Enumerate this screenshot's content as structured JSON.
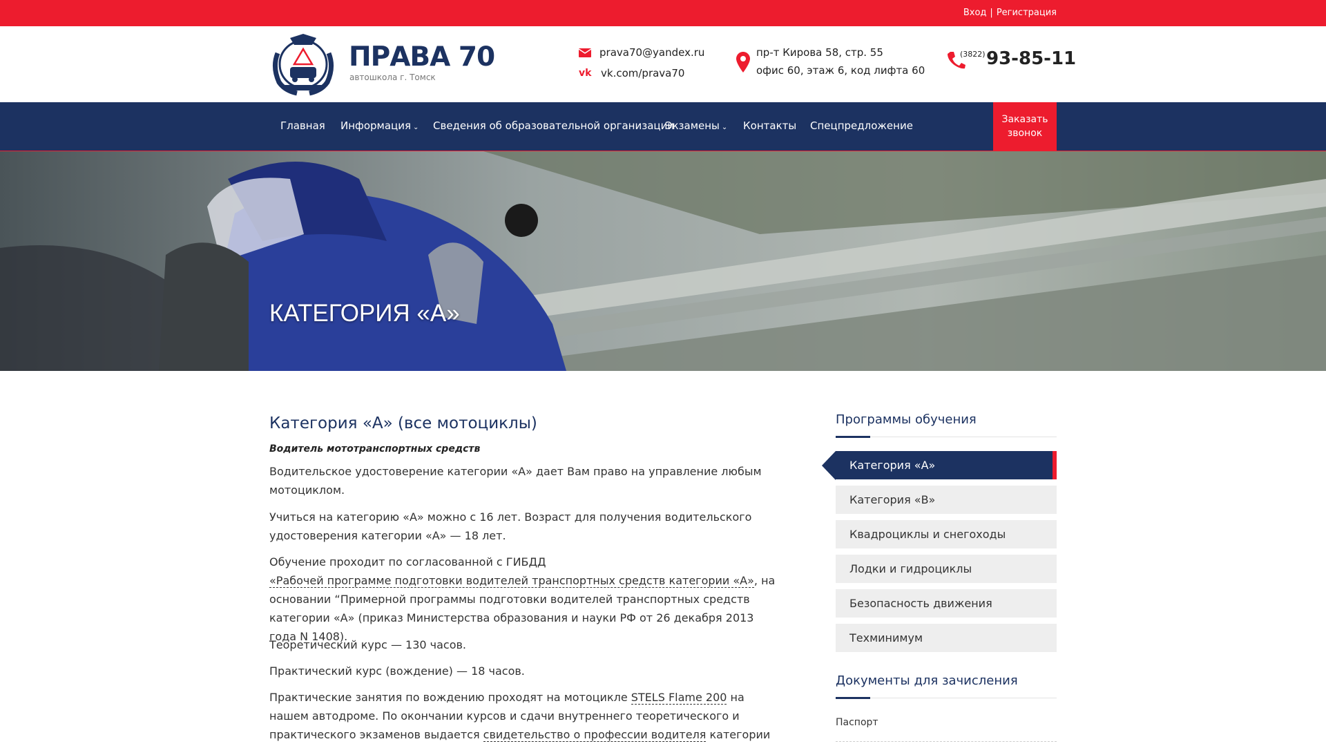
{
  "topbar": {
    "login": "Вход",
    "separator": "|",
    "register": "Регистрация"
  },
  "header": {
    "logo_title": "ПРАВА 70",
    "logo_subtitle": "автошкола г. Томск",
    "email": "prava70@yandex.ru",
    "vk": "vk.com/prava70",
    "address_line1": "пр-т Кирова 58, стр. 55",
    "address_line2": "офис 60, этаж 6, код лифта 60",
    "phone_code": "(3822)",
    "phone_number": "93-85-11"
  },
  "nav": {
    "items": [
      {
        "label": "Главная",
        "dropdown": false
      },
      {
        "label": "Информация",
        "dropdown": true
      },
      {
        "label": "Сведения об образовательной организации",
        "dropdown": false
      },
      {
        "label": "Экзамены",
        "dropdown": true
      },
      {
        "label": "Контакты",
        "dropdown": false
      },
      {
        "label": "Спецпредложение",
        "dropdown": false
      }
    ],
    "cta_line1": "Заказать",
    "cta_line2": "звонок"
  },
  "hero": {
    "title": "КАТЕГОРИЯ «А»"
  },
  "main": {
    "heading": "Категория «А» (все мотоциклы)",
    "subheading": "Водитель мототранспортных средств",
    "p1": "Водительское удостоверение категории «А» дает Вам право на управление любым мотоциклом.",
    "p2": "Учиться на категорию «А» можно с 16 лет. Возраст для получения водительского удостоверения категории «А» — 18 лет.",
    "p3_a": "Обучение проходит по согласованной с ГИБДД",
    "p3_link": "«Рабочей программе подготовки водителей транспортных средств категории «А»",
    "p3_b": ", на основании “Примерной программы подготовки водителей транспортных средств категории «А» (приказ Министерства образования и науки РФ от 26 декабря 2013 года N 1408).",
    "p4": "Теоретический курс — 130 часов.",
    "p5": "Практический курс (вождение) — 18 часов.",
    "p6_a": "Практические занятия по вождению проходят на мотоцикле ",
    "p6_link1": "STELS Flame 200",
    "p6_b": " на нашем автодроме. По окончании курсов и сдачи внутреннего теоретического и практического экзаменов выдается ",
    "p6_link2": "свидетельство о профессии водителя",
    "p6_c": " категории «А» и формируется весь"
  },
  "sidebar": {
    "programs_title": "Программы обучения",
    "programs": [
      {
        "label": "Категория «А»",
        "active": true
      },
      {
        "label": "Категория «В»",
        "active": false
      },
      {
        "label": "Квадроциклы и снегоходы",
        "active": false
      },
      {
        "label": "Лодки и гидроциклы",
        "active": false
      },
      {
        "label": "Безопасность движения",
        "active": false
      },
      {
        "label": "Техминимум",
        "active": false
      }
    ],
    "docs_title": "Документы для зачисления",
    "docs": [
      "Паспорт"
    ]
  },
  "colors": {
    "accent_red": "#ed1c2e",
    "brand_navy": "#1c3261"
  }
}
